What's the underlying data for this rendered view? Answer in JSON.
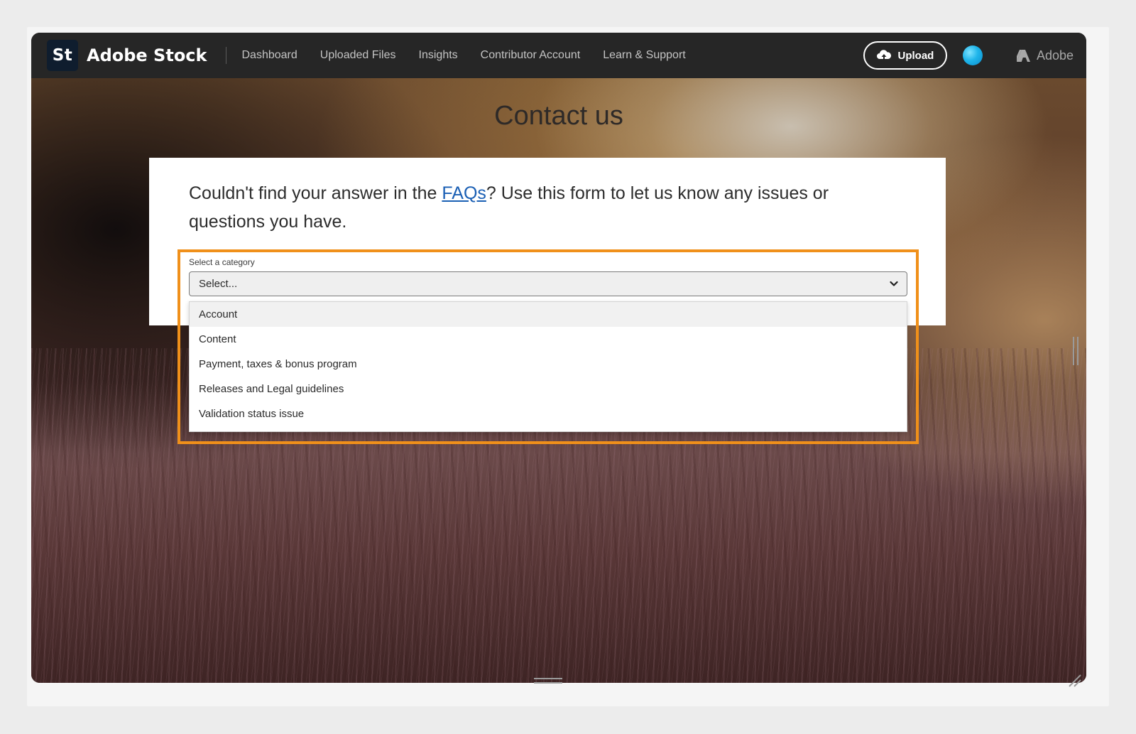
{
  "header": {
    "logo_text": "St",
    "brand": "Adobe Stock",
    "nav": [
      "Dashboard",
      "Uploaded Files",
      "Insights",
      "Contributor Account",
      "Learn & Support"
    ],
    "upload_label": "Upload",
    "adobe_label": "Adobe"
  },
  "page": {
    "title": "Contact us",
    "intro_before": "Couldn't find your answer in the ",
    "faq_link": "FAQs",
    "intro_after": "? Use this form to let us know any issues or questions you have."
  },
  "form": {
    "category_label": "Select a category",
    "select_value": "Select...",
    "options": [
      "Account",
      "Content",
      "Payment, taxes & bonus program",
      "Releases and Legal guidelines",
      "Validation status issue"
    ]
  },
  "colors": {
    "highlight": "#f0901a",
    "header_bg": "#262626",
    "link": "#1a5fb4"
  },
  "icons": {
    "upload": "cloud-upload-icon",
    "avatar": "user-avatar",
    "adobe": "adobe-logo-icon",
    "chevron": "chevron-down-icon"
  }
}
